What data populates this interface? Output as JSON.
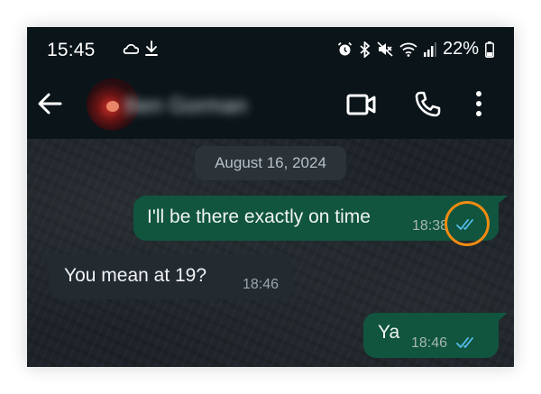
{
  "status_bar": {
    "time": "15:45",
    "left_icons": [
      "cloud-icon",
      "download-icon"
    ],
    "right_icons": [
      "alarm-icon",
      "bluetooth-icon",
      "mute-icon",
      "wifi-icon",
      "signal-icon",
      "battery-icon"
    ],
    "battery": "22%"
  },
  "header": {
    "contact_name": "Ben Gorman",
    "icons": [
      "back-arrow-icon",
      "video-call-icon",
      "phone-call-icon",
      "more-vertical-icon"
    ]
  },
  "chat": {
    "date_separator": "August 16, 2024",
    "messages": [
      {
        "direction": "outgoing",
        "text": "I'll be there exactly on time",
        "time": "18:38",
        "status": "read"
      },
      {
        "direction": "incoming",
        "text": "You mean at 19?",
        "time": "18:46"
      },
      {
        "direction": "outgoing",
        "text": "Ya",
        "time": "18:46",
        "status": "read"
      }
    ]
  },
  "colors": {
    "outgoing_bubble": "#11553e",
    "incoming_bubble": "#232b31",
    "read_ticks": "#53bdeb",
    "highlight": "#f08b12"
  }
}
